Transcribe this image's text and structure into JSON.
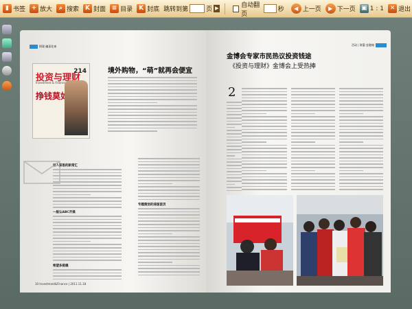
{
  "toolbar": {
    "bookmark": "书签",
    "zoom_in": "放大",
    "search": "搜索",
    "cover": "封面",
    "toc": "目录",
    "back_cover": "封底",
    "jump_label": "跳转到第",
    "page_unit": "页",
    "autoflip": "自动翻页",
    "seconds": "秒",
    "prev": "上一页",
    "next": "下一页",
    "ratio": "1 : 1",
    "exit": "退出"
  },
  "left_page": {
    "tag": "财观 编读往来",
    "cover_title": "投资与理财",
    "cover_number": "214",
    "cover_subtitle": "Investment & Finance",
    "cover_headline": "挣钱莫如减钱",
    "headline": "境外购物，“萌”就再会便宜",
    "side_title1": "引人深思的新常汇",
    "side_title2": "一般认ABC开搞",
    "side_title3": "希望多挑稿",
    "suggestion_title": "专题策划的排版首页",
    "footer": "10 Investment&Finance | 2011.11.18"
  },
  "right_page": {
    "tag": "活动 | 财富·金融城",
    "headline1": "金博会专家市民热议投资钱途",
    "headline2": "《投资与理财》金博会上受热捧",
    "big_char": "2"
  },
  "colors": {
    "toolbar_top": "#fdf3d8",
    "toolbar_bottom": "#e7c98d",
    "accent": "#e46a22",
    "tag_blue": "#2a8bcf",
    "cover_red": "#d11a2a"
  }
}
